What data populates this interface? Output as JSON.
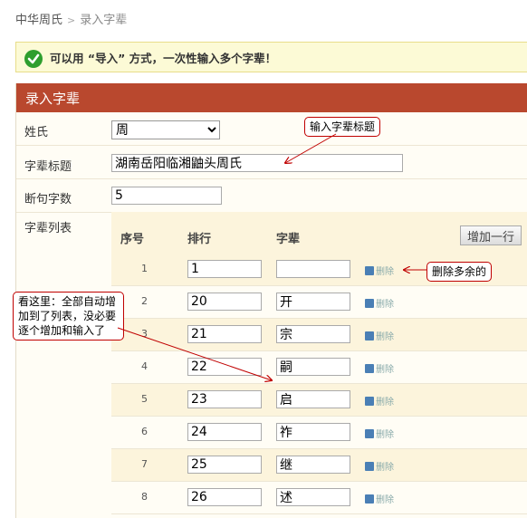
{
  "breadcrumb": {
    "home": "中华周氏",
    "sep": ">",
    "current": "录入字辈"
  },
  "notice": {
    "text": "可以用 “导入” 方式，一次性输入多个字辈！"
  },
  "panel": {
    "title": "录入字辈"
  },
  "form": {
    "surname_label": "姓氏",
    "surname_value": "周",
    "title_label": "字辈标题",
    "title_value": "湖南岳阳临湘鼬头周氏",
    "break_label": "断句字数",
    "break_value": "5",
    "list_label": "字辈列表"
  },
  "list": {
    "headers": {
      "index": "序号",
      "rank": "排行",
      "gen": "字辈"
    },
    "add_button": "增加一行",
    "delete_label": "删除",
    "rows": [
      {
        "index": "1",
        "rank": "1",
        "gen": ""
      },
      {
        "index": "2",
        "rank": "20",
        "gen": "开"
      },
      {
        "index": "3",
        "rank": "21",
        "gen": "宗"
      },
      {
        "index": "4",
        "rank": "22",
        "gen": "嗣"
      },
      {
        "index": "5",
        "rank": "23",
        "gen": "启"
      },
      {
        "index": "6",
        "rank": "24",
        "gen": "祚"
      },
      {
        "index": "7",
        "rank": "25",
        "gen": "继"
      },
      {
        "index": "8",
        "rank": "26",
        "gen": "述"
      }
    ]
  },
  "annotations": {
    "title_note": "输入字辈标题",
    "delete_note": "删除多余的",
    "auto_note": "看这里：全部自动增加到了列表，没必要逐个增加和输入了"
  }
}
